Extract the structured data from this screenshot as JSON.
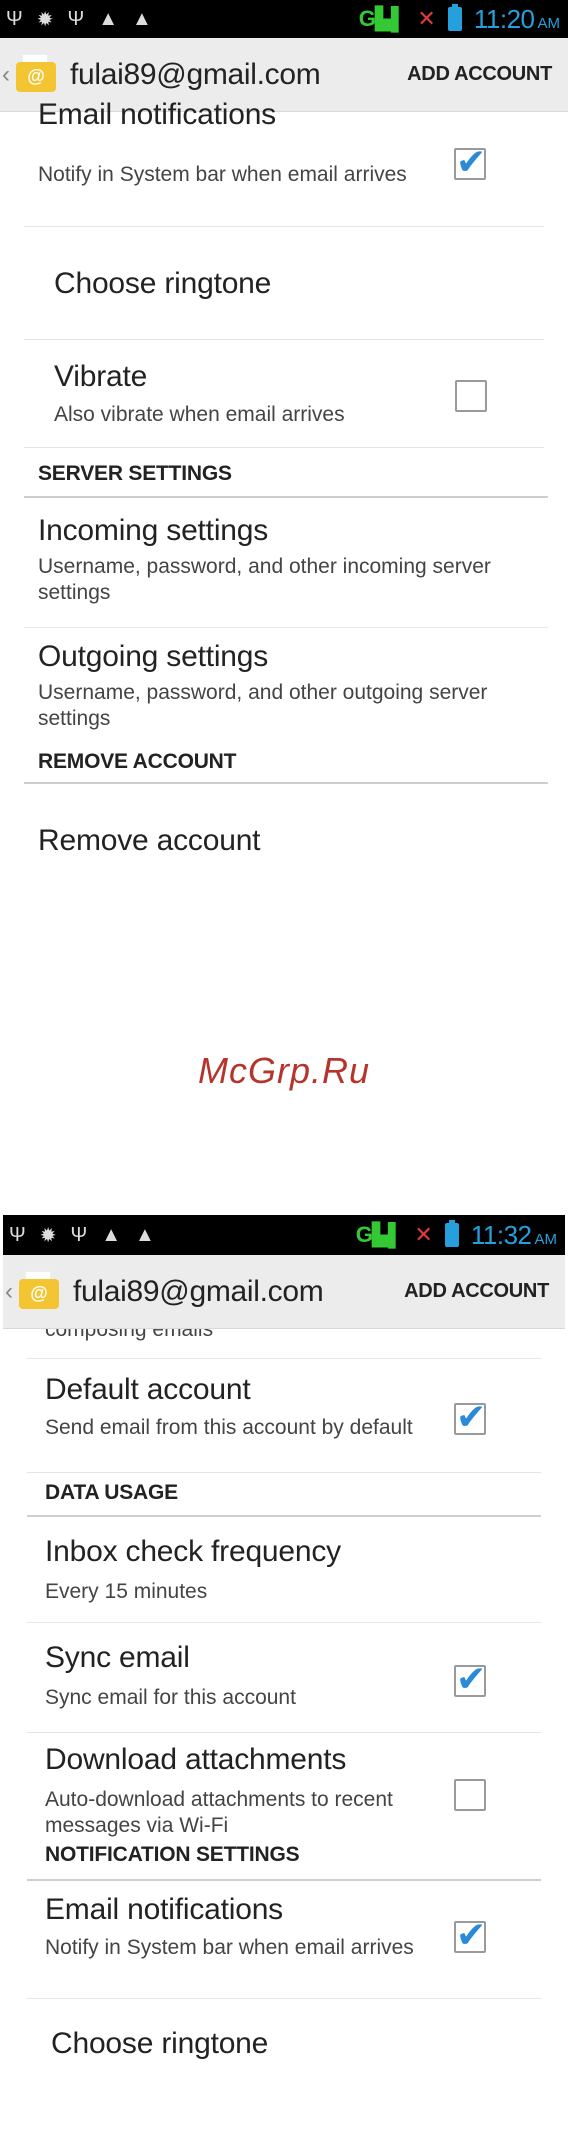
{
  "screen1": {
    "status": {
      "time": "11:20",
      "ampm": "AM",
      "signal": "G"
    },
    "action_bar": {
      "title": "fulai89@gmail.com",
      "add_account": "ADD ACCOUNT"
    },
    "items": [
      {
        "title": "Email notifications",
        "summary": "Notify in System bar when email arrives",
        "checked": true
      },
      {
        "title": "Choose ringtone"
      },
      {
        "title": "Vibrate",
        "summary": "Also vibrate when email arrives",
        "checked": false
      }
    ],
    "category_server": "SERVER SETTINGS",
    "incoming": {
      "title": "Incoming settings",
      "summary": "Username, password, and other incoming server settings"
    },
    "outgoing": {
      "title": "Outgoing settings",
      "summary": "Username, password, and other outgoing server settings"
    },
    "category_remove": "REMOVE ACCOUNT",
    "remove": {
      "title": "Remove account"
    }
  },
  "watermark": "McGrp.Ru",
  "screen2": {
    "status": {
      "time": "11:32",
      "ampm": "AM",
      "signal": "G"
    },
    "action_bar": {
      "title": "fulai89@gmail.com",
      "add_account": "ADD ACCOUNT"
    },
    "clipped_top": "composing emails",
    "default_account": {
      "title": "Default account",
      "summary": "Send email from this account by default",
      "checked": true
    },
    "category_data": "DATA USAGE",
    "inbox_check": {
      "title": "Inbox check frequency",
      "summary": "Every 15 minutes"
    },
    "sync": {
      "title": "Sync email",
      "summary": "Sync email for this account",
      "checked": true
    },
    "download": {
      "title": "Download attachments",
      "summary": "Auto-download attachments to recent messages via Wi-Fi",
      "checked": false
    },
    "category_notify": "NOTIFICATION SETTINGS",
    "email_notifications": {
      "title": "Email notifications",
      "summary": "Notify in System bar when email arrives",
      "checked": true
    },
    "choose_ringtone": {
      "title": "Choose ringtone"
    }
  }
}
